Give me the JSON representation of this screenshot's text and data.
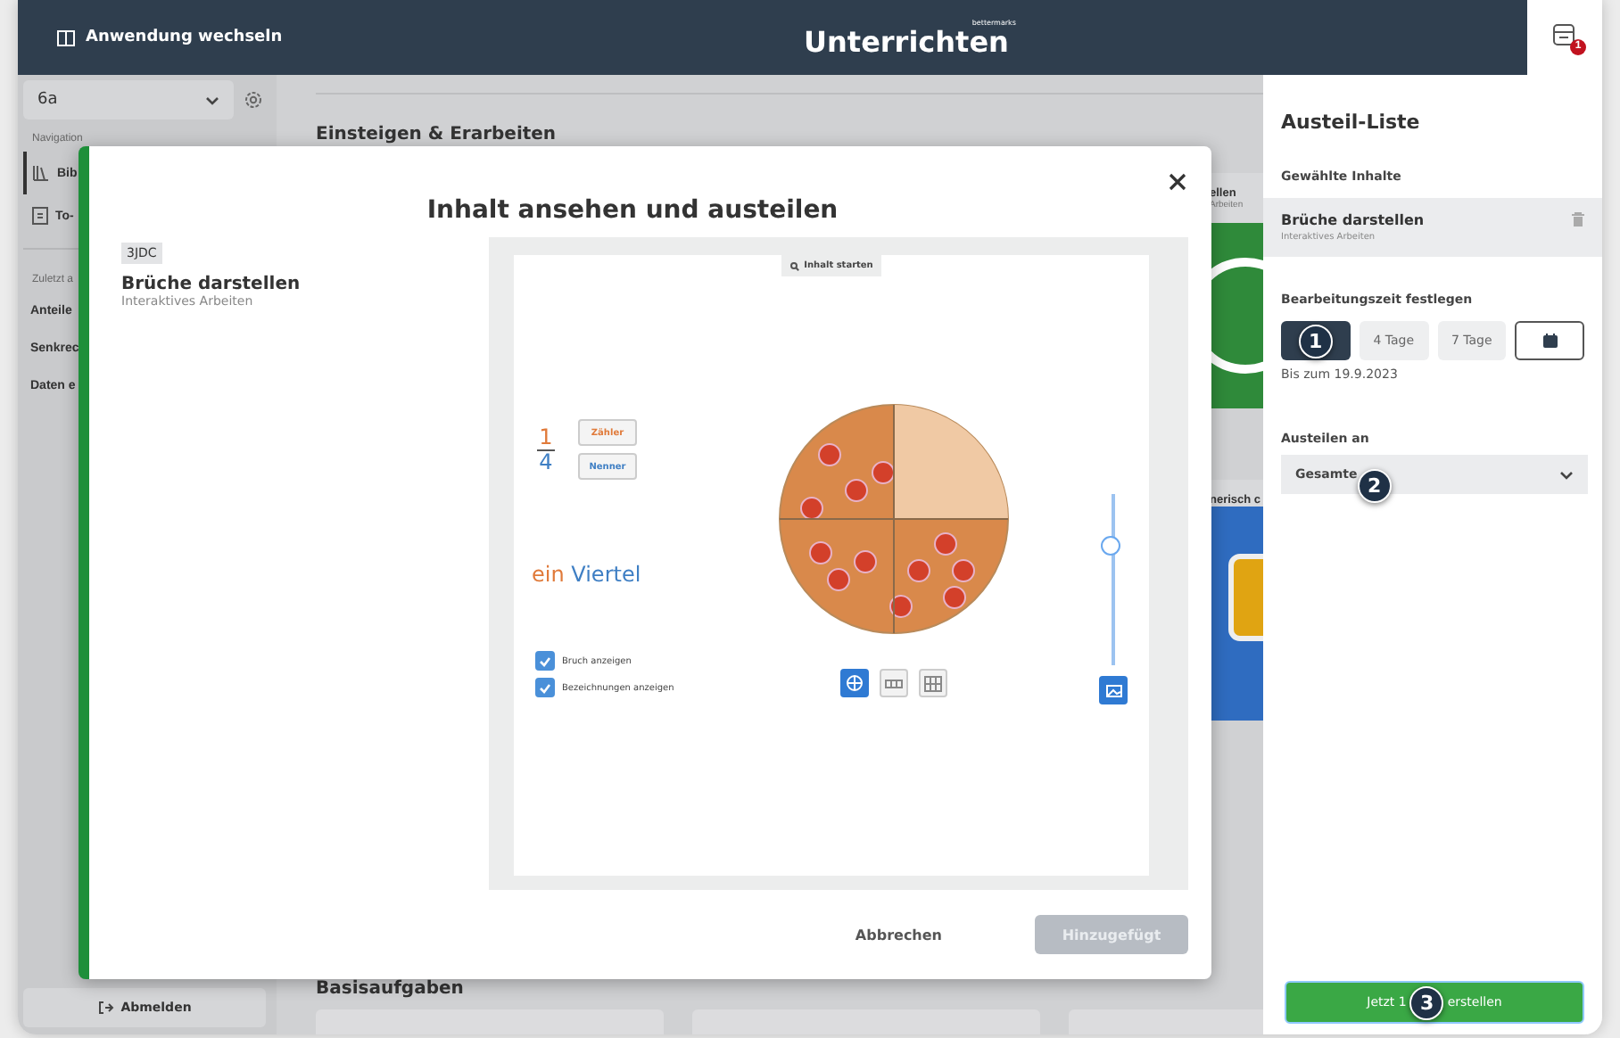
{
  "header": {
    "switch_label": "Anwendung wechseln",
    "logo_brand": "bettermarks",
    "logo_title": "Unterrichten",
    "notification_count": "1"
  },
  "sidebar": {
    "class_select": "6a",
    "nav_heading": "Navigation",
    "nav_items": [
      {
        "label": "Bib",
        "selected": true,
        "kind": "library"
      },
      {
        "label": "To-",
        "selected": false,
        "kind": "todo"
      }
    ],
    "recent_heading": "Zuletzt a",
    "recent_items": [
      "Anteile",
      "Senkrec",
      "Daten e"
    ],
    "logout": "Abmelden"
  },
  "main": {
    "section_title": "Einsteigen & Erarbeiten",
    "cards": [
      {
        "title": "ellen",
        "subtitle": "Arbeiten",
        "kind": "green"
      },
      {
        "title": "nerisch c",
        "kind": "blue"
      }
    ],
    "bottom_section_title": "Basisaufgaben"
  },
  "modal": {
    "title": "Inhalt ansehen und austeilen",
    "tag": "3JDC",
    "content_title": "Brüche darstellen",
    "content_subtitle": "Interaktives Arbeiten",
    "preview": {
      "start_button": "Inhalt starten",
      "numerator": "1",
      "denominator": "4",
      "numerator_button": "Zähler",
      "denominator_button": "Nenner",
      "word_1": "ein",
      "word_2": "Viertel",
      "checkboxes": [
        {
          "label": "Bruch anzeigen",
          "checked": true
        },
        {
          "label": "Bezeichnungen anzeigen",
          "checked": true
        }
      ],
      "view_modes": [
        {
          "kind": "circle",
          "selected": true
        },
        {
          "kind": "bar",
          "selected": false
        },
        {
          "kind": "grid",
          "selected": false
        }
      ],
      "slider": {
        "level": 0.7
      }
    },
    "cancel": "Abbrechen",
    "submit": {
      "label": "Hinzugefügt",
      "disabled": true
    }
  },
  "panel": {
    "title": "Austeil-Liste",
    "chosen_heading": "Gewählte Inhalte",
    "chosen_items": [
      {
        "title": "Brüche darstellen",
        "subtitle": "Interaktives Arbeiten"
      }
    ],
    "time_heading": "Bearbeitungszeit festlegen",
    "durations": [
      {
        "kind": "marker",
        "marker": "1",
        "selected": true
      },
      {
        "kind": "text",
        "label": "4 Tage",
        "selected": false
      },
      {
        "kind": "text",
        "label": "7 Tage",
        "selected": false
      },
      {
        "kind": "calendar",
        "selected": false
      }
    ],
    "due_text": "Bis zum 19.9.2023",
    "recipients_heading": "Austeilen an",
    "recipients_value": "Gesamte",
    "recipients_marker": "2",
    "create_button": {
      "before": "Jetzt 1",
      "marker": "3",
      "after": "erstellen"
    }
  }
}
